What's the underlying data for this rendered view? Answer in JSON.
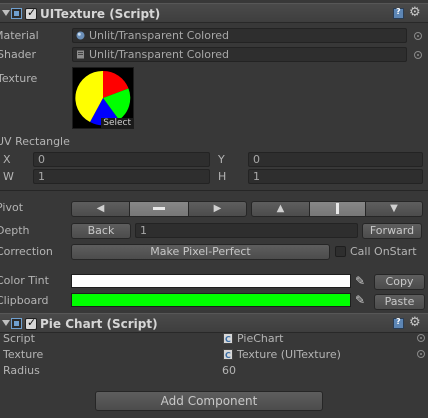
{
  "uitexture": {
    "title": "UITexture (Script)",
    "material_label": "Material",
    "material_value": "Unlit/Transparent Colored",
    "shader_label": "Shader",
    "shader_value": "Unlit/Transparent Colored",
    "texture_label": "Texture",
    "texture_select": "Select",
    "uv_label": "UV Rectangle",
    "x_label": "X",
    "x_value": "0",
    "y_label": "Y",
    "y_value": "0",
    "w_label": "W",
    "w_value": "1",
    "h_label": "H",
    "h_value": "1",
    "pivot_label": "Pivot",
    "depth_label": "Depth",
    "depth_back": "Back",
    "depth_value": "1",
    "depth_forward": "Forward",
    "correction_label": "Correction",
    "make_pixel_perfect": "Make Pixel-Perfect",
    "call_onstart": "Call OnStart",
    "color_tint_label": "Color Tint",
    "color_tint": "#ffffff",
    "copy_button": "Copy",
    "clipboard_label": "Clipboard",
    "clipboard_color": "#00ff00",
    "paste_button": "Paste"
  },
  "pie_colors": [
    "#ff0000",
    "#00ff00",
    "#0000ff",
    "#ffff00"
  ],
  "piechart": {
    "title": "Pie Chart (Script)",
    "script_label": "Script",
    "script_value": "PieChart",
    "texture_label": "Texture",
    "texture_value": "Texture (UITexture)",
    "radius_label": "Radius",
    "radius_value": "60"
  },
  "add_component": "Add Component"
}
